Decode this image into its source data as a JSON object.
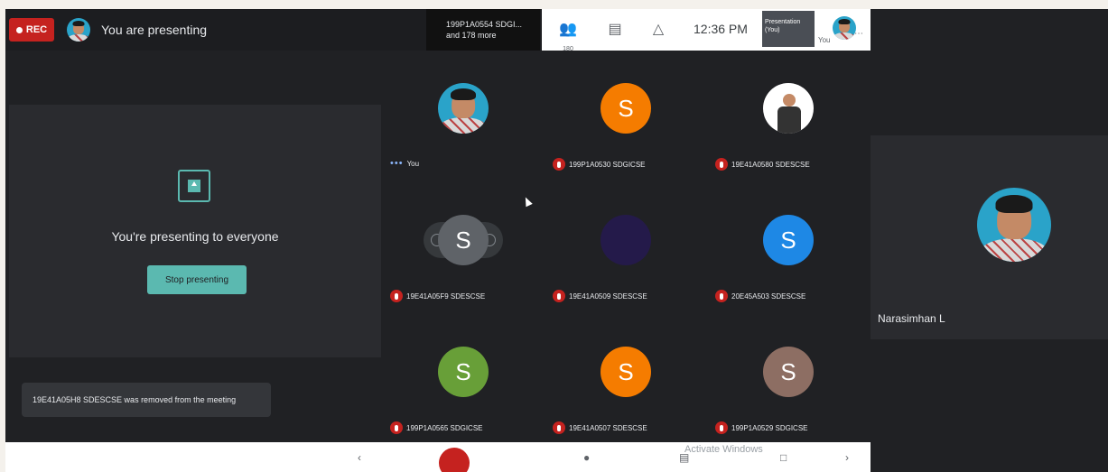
{
  "window": {
    "rec_label": "REC",
    "presenter_banner": "You are presenting",
    "top_presenter": {
      "line1": "199P1A0554 SDGI...",
      "line2": "and 178 more"
    },
    "participants_count": "180",
    "clock": "12:36 PM",
    "presentation_thumb": {
      "line1": "Presentation",
      "line2": "(You)"
    },
    "you_label": "You"
  },
  "presenting": {
    "title": "You're presenting to everyone",
    "stop_button": "Stop presenting",
    "notice": "19E41A05H8 SDESCSE was removed from the meeting"
  },
  "tiles": [
    {
      "name": "You",
      "initial": "",
      "color": "#2aa3c9",
      "kind": "photo",
      "muted": false
    },
    {
      "name": "199P1A0530 SDGICSE",
      "initial": "S",
      "color": "#f57c00",
      "kind": "letter",
      "muted": true
    },
    {
      "name": "19E41A0580 SDESCSE",
      "initial": "",
      "color": "#ffffff",
      "kind": "photo2",
      "muted": true
    },
    {
      "name": "19E41A05F9 SDESCSE",
      "initial": "S",
      "color": "#5f6368",
      "kind": "hover",
      "muted": true
    },
    {
      "name": "19E41A0509 SDESCSE",
      "initial": "",
      "color": "#241a4a",
      "kind": "poster",
      "muted": true
    },
    {
      "name": "20E45A503 SDESCSE",
      "initial": "S",
      "color": "#1e88e5",
      "kind": "letter",
      "muted": true
    },
    {
      "name": "199P1A0565 SDGICSE",
      "initial": "S",
      "color": "#689f38",
      "kind": "letter",
      "muted": true
    },
    {
      "name": "19E41A0507 SDESCSE",
      "initial": "S",
      "color": "#f57c00",
      "kind": "letter",
      "muted": true
    },
    {
      "name": "199P1A0529 SDGICSE",
      "initial": "S",
      "color": "#8d6e63",
      "kind": "letter",
      "muted": true
    }
  ],
  "right_panel": {
    "name": "Narasimhan L"
  },
  "bottom": {
    "activate": "Activate Windows"
  },
  "colors": {
    "accent": "#5bb9b0",
    "rec": "#c5221f",
    "background": "#202124"
  }
}
